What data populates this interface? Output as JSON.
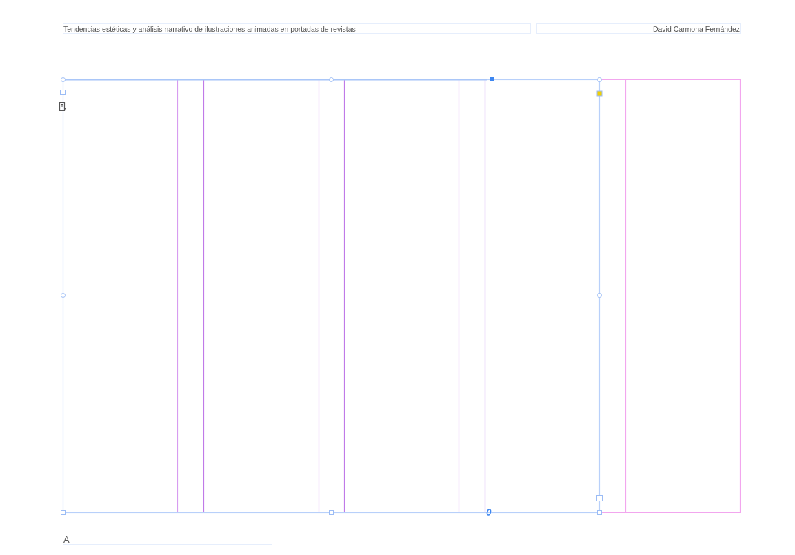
{
  "header": {
    "title": "Tendencias estéticas y análisis narrativo de ilustraciones animadas en portadas de revistas",
    "author": "David Carmona Fernández"
  },
  "footer": {
    "label": "A"
  }
}
